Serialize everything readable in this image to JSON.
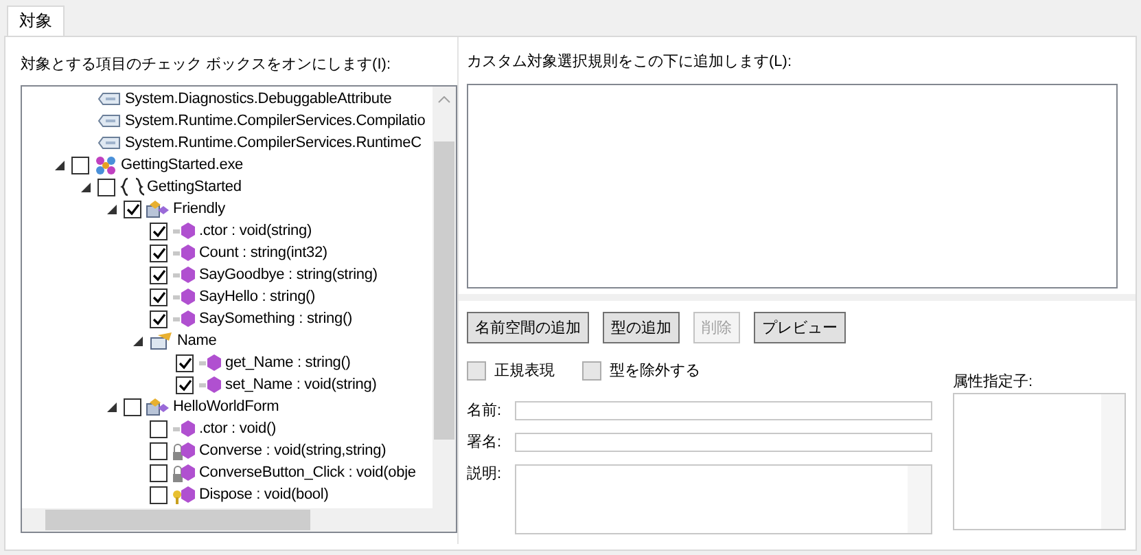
{
  "tabs": [
    {
      "label": "対象",
      "selected": true
    }
  ],
  "left": {
    "label": "対象とする項目のチェック ボックスをオンにします(I):",
    "tree": [
      {
        "kind": "attribute",
        "label": "System.Diagnostics.DebuggableAttribute"
      },
      {
        "kind": "attribute",
        "label": "System.Runtime.CompilerServices.Compilatio"
      },
      {
        "kind": "attribute",
        "label": "System.Runtime.CompilerServices.RuntimeC"
      },
      {
        "kind": "assembly",
        "label": "GettingStarted.exe",
        "checked": false,
        "expanded": true,
        "children": [
          {
            "kind": "namespace",
            "label": "GettingStarted",
            "checked": false,
            "expanded": true,
            "children": [
              {
                "kind": "class",
                "label": "Friendly",
                "checked": true,
                "expanded": true,
                "children": [
                  {
                    "kind": "method",
                    "label": ".ctor : void(string)",
                    "checked": true
                  },
                  {
                    "kind": "method",
                    "label": "Count : string(int32)",
                    "checked": true
                  },
                  {
                    "kind": "method",
                    "label": "SayGoodbye : string(string)",
                    "checked": true
                  },
                  {
                    "kind": "method",
                    "label": "SayHello : string()",
                    "checked": true
                  },
                  {
                    "kind": "method",
                    "label": "SaySomething : string()",
                    "checked": true
                  },
                  {
                    "kind": "property",
                    "label": "Name",
                    "expanded": true,
                    "children": [
                      {
                        "kind": "method",
                        "label": "get_Name : string()",
                        "checked": true
                      },
                      {
                        "kind": "method",
                        "label": "set_Name : void(string)",
                        "checked": true
                      }
                    ]
                  }
                ]
              },
              {
                "kind": "class",
                "label": "HelloWorldForm",
                "checked": false,
                "expanded": true,
                "children": [
                  {
                    "kind": "method",
                    "label": ".ctor : void()",
                    "checked": false
                  },
                  {
                    "kind": "private-method",
                    "label": "Converse : void(string,string)",
                    "checked": false
                  },
                  {
                    "kind": "private-method",
                    "label": "ConverseButton_Click : void(obje",
                    "checked": false
                  },
                  {
                    "kind": "protected-method",
                    "label": "Dispose : void(bool)",
                    "checked": false
                  }
                ]
              }
            ]
          }
        ]
      }
    ]
  },
  "right": {
    "label": "カスタム対象選択規則をこの下に追加します(L):",
    "buttons": [
      {
        "label": "名前空間の追加",
        "disabled": false
      },
      {
        "label": "型の追加",
        "disabled": false
      },
      {
        "label": "削除",
        "disabled": true
      },
      {
        "label": "プレビュー",
        "disabled": false
      }
    ],
    "options": [
      {
        "label": "正規表現",
        "checked": false
      },
      {
        "label": "型を除外する",
        "checked": false
      }
    ],
    "fields": [
      {
        "label": "名前:"
      },
      {
        "label": "署名:"
      },
      {
        "label": "説明:",
        "multiline": true
      }
    ],
    "attributes_label": "属性指定子:"
  }
}
